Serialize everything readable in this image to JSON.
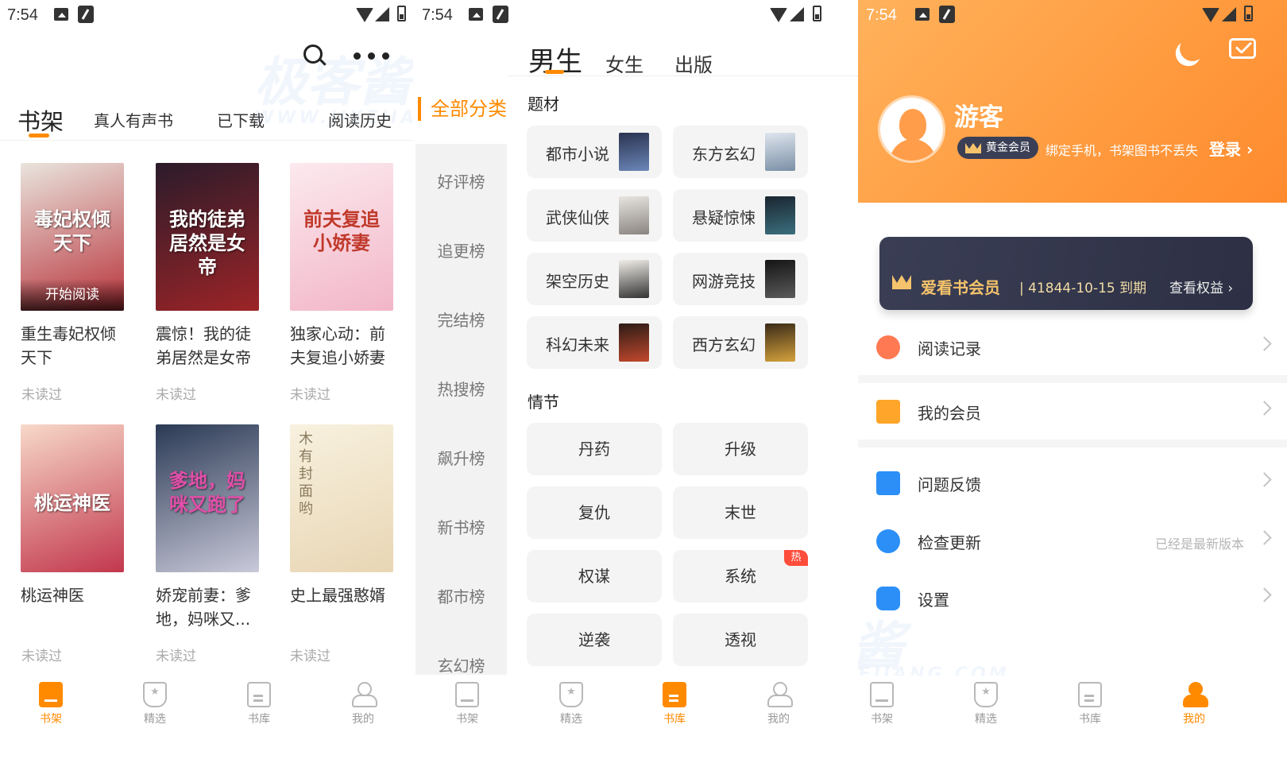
{
  "status_bar": {
    "time": "7:54"
  },
  "shelf": {
    "tabs": [
      {
        "label": "书架"
      },
      {
        "label": "真人有声书"
      },
      {
        "label": "已下载"
      },
      {
        "label": "阅读历史"
      }
    ],
    "books": [
      {
        "title": "重生毒妃权倾天下",
        "cover_text": "毒妃权倾天下",
        "cta": "开始阅读",
        "status": "未读过",
        "colors": [
          "#e9e4dd",
          "#b8323a"
        ]
      },
      {
        "title": "震惊！我的徒弟居然是女帝",
        "cover_text": "我的徒弟居然是女帝",
        "status": "未读过",
        "colors": [
          "#2b1b2a",
          "#9c2427"
        ]
      },
      {
        "title": "独家心动：前夫复追小娇妻",
        "cover_text": "前夫复追小娇妻",
        "status": "未读过",
        "colors": [
          "#fce9ee",
          "#f2b6c8"
        ]
      },
      {
        "title": "桃运神医",
        "cover_text": "桃运神医",
        "status": "未读过",
        "colors": [
          "#f7d9c9",
          "#c2374d"
        ]
      },
      {
        "title": "娇宠前妻：爹地，妈咪又...",
        "cover_text": "爹地，妈咪又跑了",
        "status": "未读过",
        "colors": [
          "#2b3a55",
          "#c9c9d9"
        ]
      },
      {
        "title": "史上最强憨婿",
        "cover_text": "木有封面哟",
        "status": "未读过",
        "colors": [
          "#f8f1df",
          "#e8d6b4"
        ]
      }
    ]
  },
  "library": {
    "all_categories": "全部分类",
    "top_tabs": [
      {
        "label": "男生"
      },
      {
        "label": "女生"
      },
      {
        "label": "出版"
      }
    ],
    "ranks": [
      "好评榜",
      "追更榜",
      "完结榜",
      "热搜榜",
      "飙升榜",
      "新书榜",
      "都市榜",
      "玄幻榜"
    ],
    "sections": {
      "genre": "题材",
      "plot": "情节"
    },
    "genres": [
      {
        "label": "都市小说",
        "thumb": [
          "#2a3350",
          "#6b86b8"
        ]
      },
      {
        "label": "东方玄幻",
        "thumb": [
          "#dfe6ee",
          "#7a8fa6"
        ]
      },
      {
        "label": "武侠仙侠",
        "thumb": [
          "#e7e4df",
          "#8a8580"
        ]
      },
      {
        "label": "悬疑惊悚",
        "thumb": [
          "#1a2630",
          "#3b6e7d"
        ]
      },
      {
        "label": "架空历史",
        "thumb": [
          "#f1eee9",
          "#333333"
        ]
      },
      {
        "label": "网游竞技",
        "thumb": [
          "#151515",
          "#5a5a5a"
        ]
      },
      {
        "label": "科幻未来",
        "thumb": [
          "#2c1b17",
          "#c2482c"
        ]
      },
      {
        "label": "西方玄幻",
        "thumb": [
          "#3a2a18",
          "#d4a23c"
        ]
      }
    ],
    "plots": [
      {
        "label": "丹药"
      },
      {
        "label": "升级"
      },
      {
        "label": "复仇"
      },
      {
        "label": "末世"
      },
      {
        "label": "权谋"
      },
      {
        "label": "系统",
        "badge": "热"
      },
      {
        "label": "逆袭"
      },
      {
        "label": "透视"
      }
    ]
  },
  "profile": {
    "username": "游客",
    "member_badge": "黄金会员",
    "bind_tip": "绑定手机，书架图书不丢失",
    "login": "登录 ›",
    "vip": {
      "title": "爱看书会员",
      "expire": "| 41844-10-15 到期",
      "benefit": "查看权益 ›"
    },
    "menu": [
      {
        "label": "阅读记录",
        "color": "#ff7a52"
      },
      {
        "label": "我的会员",
        "color": "#ffa529"
      },
      {
        "label": "问题反馈",
        "color": "#2b8ff7"
      },
      {
        "label": "检查更新",
        "value": "已经是最新版本",
        "color": "#2b8ff7"
      },
      {
        "label": "设置",
        "color": "#2b8ff7"
      }
    ]
  },
  "nav": [
    {
      "label": "书架",
      "icon": "shelf-icon"
    },
    {
      "label": "精选",
      "icon": "featured-icon"
    },
    {
      "label": "书库",
      "icon": "library-icon"
    },
    {
      "label": "我的",
      "icon": "profile-icon"
    }
  ],
  "theme": {
    "accent": "#ff8a00"
  },
  "watermark": {
    "text": "极客酱",
    "domain": "WWW.JIKEJIANG.COM"
  }
}
